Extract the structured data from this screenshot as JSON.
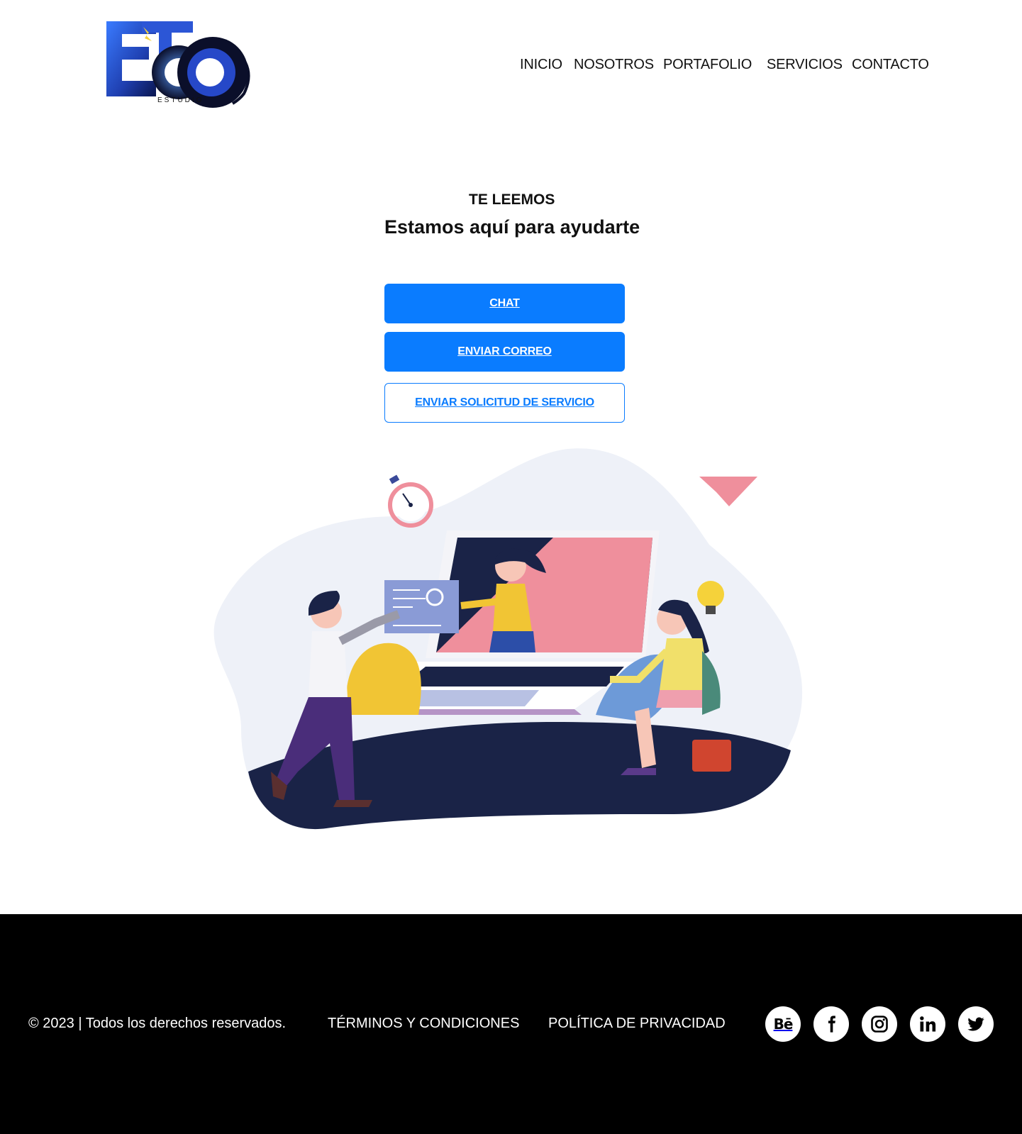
{
  "logo": {
    "subtext": "ESTUDIO"
  },
  "nav": [
    {
      "label": "INICIO"
    },
    {
      "label": "NOSOTROS"
    },
    {
      "label": "PORTAFOLIO"
    },
    {
      "label": "SERVICIOS"
    },
    {
      "label": "CONTACTO"
    }
  ],
  "hero": {
    "eyebrow": "TE LEEMOS",
    "title": "Estamos aquí para ayudarte"
  },
  "buttons": {
    "chat": "CHAT",
    "email": "ENVIAR CORREO",
    "service_request": "ENVIAR SOLICITUD DE SERVICIO"
  },
  "footer": {
    "copyright": "© 2023 | Todos los derechos reservados.",
    "terms": "TÉRMINOS Y CONDICIONES",
    "privacy": "POLÍTICA DE PRIVACIDAD",
    "behance_label": "Bē",
    "social": [
      "behance-icon",
      "facebook-icon",
      "instagram-icon",
      "linkedin-icon",
      "twitter-icon"
    ]
  },
  "colors": {
    "accent": "#0A7CFF",
    "footer_bg": "#000000",
    "text": "#111111"
  }
}
